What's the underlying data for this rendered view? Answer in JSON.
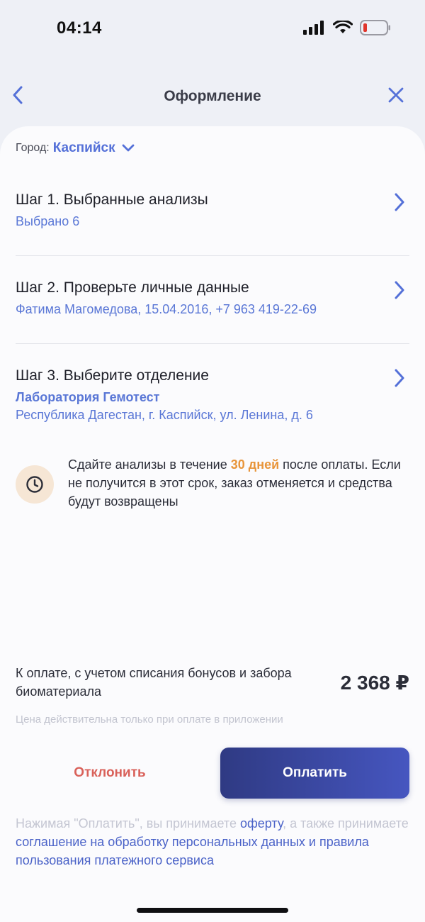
{
  "status_bar": {
    "time": "04:14"
  },
  "nav": {
    "title": "Оформление"
  },
  "city": {
    "label": "Город:",
    "value": "Каспийск"
  },
  "steps": [
    {
      "title": "Шаг 1. Выбранные анализы",
      "subtitle": "Выбрано 6"
    },
    {
      "title": "Шаг 2. Проверьте личные данные",
      "subtitle": "Фатима Магомедова, 15.04.2016, +7 963 419-22-69"
    },
    {
      "title": "Шаг 3. Выберите отделение",
      "subtitle": "Лаборатория Гемотест",
      "address": "Республика Дагестан, г. Каспийск, ул. Ленина, д. 6"
    }
  ],
  "notice": {
    "text_before": "Сдайте анализы в течение ",
    "highlight": "30 дней",
    "text_after": " после оплаты. Если не получится в этот срок, заказ отменяется и средства будут возвращены"
  },
  "payment": {
    "label": "К оплате, с учетом списания бонусов и забора биоматериала",
    "amount": "2 368 ₽",
    "note": "Цена действительна только при оплате в приложении"
  },
  "buttons": {
    "decline": "Отклонить",
    "pay": "Оплатить"
  },
  "terms": {
    "part1": "Нажимая \"Оплатить\", вы принимаете ",
    "link1": "оферту",
    "part2": ", а также принимаете ",
    "link2": "соглашение на обработку персональных данных и правила пользования платежного сервиса"
  },
  "colors": {
    "accent": "#5470d8",
    "warning": "#e8953a",
    "decline": "#d9615a",
    "pay_button": "#3a47a3"
  },
  "icons": [
    "back-icon",
    "close-icon",
    "chevron-down-icon",
    "chevron-right-icon",
    "clock-icon",
    "signal-icon",
    "wifi-icon",
    "battery-icon"
  ]
}
